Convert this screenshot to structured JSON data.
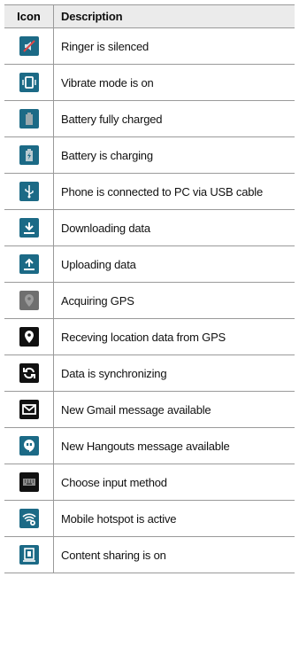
{
  "header": {
    "icon": "Icon",
    "description": "Description"
  },
  "rows": [
    {
      "icon": "ringer-silenced-icon",
      "description": "Ringer is silenced"
    },
    {
      "icon": "vibrate-icon",
      "description": "Vibrate mode is on"
    },
    {
      "icon": "battery-full-icon",
      "description": "Battery fully charged"
    },
    {
      "icon": "battery-charging-icon",
      "description": "Battery is charging"
    },
    {
      "icon": "usb-icon",
      "description": "Phone is connected to PC via USB cable"
    },
    {
      "icon": "download-icon",
      "description": "Downloading data"
    },
    {
      "icon": "upload-icon",
      "description": "Uploading data"
    },
    {
      "icon": "gps-acquiring-icon",
      "description": "Acquiring GPS"
    },
    {
      "icon": "gps-location-icon",
      "description": "Receving location data from GPS"
    },
    {
      "icon": "sync-icon",
      "description": "Data is synchronizing"
    },
    {
      "icon": "gmail-icon",
      "description": "New Gmail message available"
    },
    {
      "icon": "hangouts-icon",
      "description": "New Hangouts message available"
    },
    {
      "icon": "keyboard-icon",
      "description": "Choose input method"
    },
    {
      "icon": "hotspot-icon",
      "description": "Mobile hotspot is active"
    },
    {
      "icon": "content-sharing-icon",
      "description": "Content sharing is on"
    }
  ],
  "colors": {
    "icon_tile_teal": "#1c6a86",
    "icon_tile_dark": "#111111",
    "grid_line": "#9a9a9a",
    "header_bg": "#ebebeb"
  }
}
